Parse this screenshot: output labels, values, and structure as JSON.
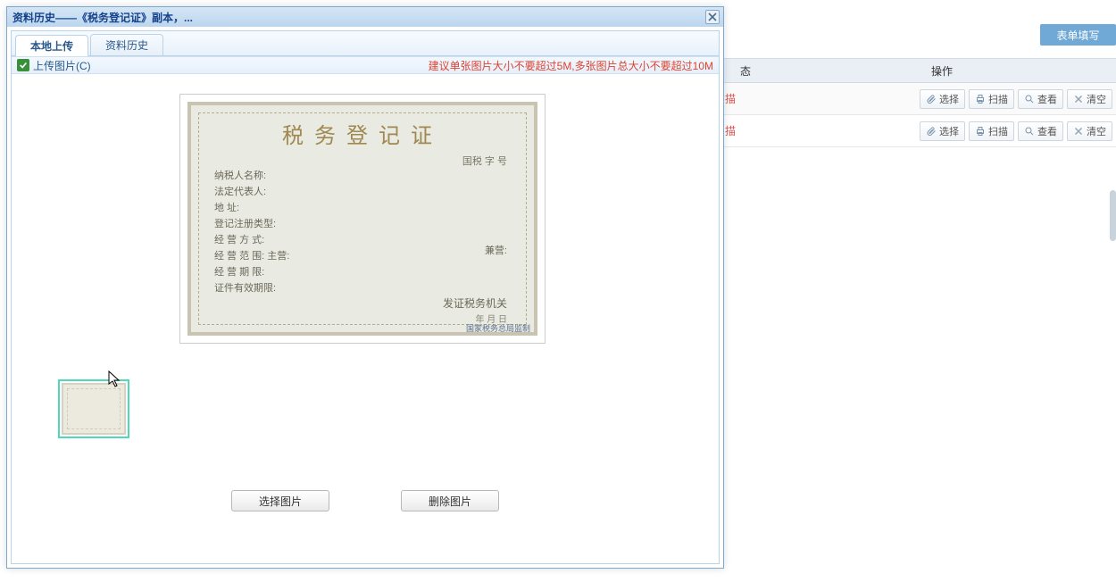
{
  "toolbar": {
    "form_fill": "表单填写"
  },
  "grid": {
    "headers": {
      "status": "态",
      "ops": "操作"
    },
    "rows": [
      {
        "status": "描"
      },
      {
        "status": "描"
      }
    ],
    "buttons": {
      "select": "选择",
      "scan": "扫描",
      "view": "查看",
      "clear": "清空"
    }
  },
  "modal": {
    "title": "资料历史——《税务登记证》副本，...",
    "tabs": {
      "local": "本地上传",
      "history": "资料历史"
    },
    "upload_label": "上传图片(C)",
    "hint": "建议单张图片大小不要超过5M,多张图片总大小不要超过10M",
    "choose_image": "选择图片",
    "delete_image": "删除图片"
  },
  "certificate": {
    "title": "税务登记证",
    "regno_label": "国税 字            号",
    "lines": [
      "纳税人名称:",
      "法定代表人:",
      "地        址:",
      "登记注册类型:",
      "经 营 方 式:",
      "经 营 范 围: 主营:",
      "",
      "经 营 期 限:",
      "证件有效期限:"
    ],
    "side_label": "兼营:",
    "issuer": "发证税务机关",
    "date": "年    月    日",
    "footer": "国家税务总局监制"
  },
  "icons": {
    "close": "close-icon",
    "check": "check-icon",
    "clip": "clip-icon",
    "printer": "printer-icon",
    "magnifier": "magnifier-icon",
    "cross": "cross-icon"
  }
}
